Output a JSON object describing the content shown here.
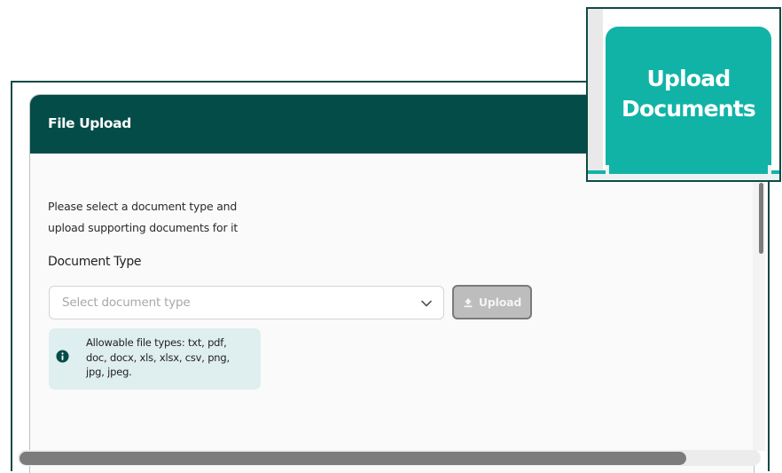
{
  "modal": {
    "title": "File Upload",
    "intro_line1": "Please select a document type and",
    "intro_line2": "upload supporting documents for it",
    "document_type_label": "Document Type",
    "select_placeholder": "Select document type",
    "upload_button_label": "Upload",
    "info_text": "Allowable file types: txt, pdf, doc, docx, xls, xlsx, csv, png, jpg, jpeg."
  },
  "callout": {
    "tile_label_line1": "Upload",
    "tile_label_line2": "Documents"
  },
  "icons": {
    "chevron": "chevron-down-icon",
    "upload": "upload-icon",
    "info": "info-icon"
  },
  "colors": {
    "header_bg": "#034c48",
    "accent_teal": "#11b3a7",
    "info_bg": "#dfeeee",
    "button_disabled": "#bdbdbd"
  }
}
